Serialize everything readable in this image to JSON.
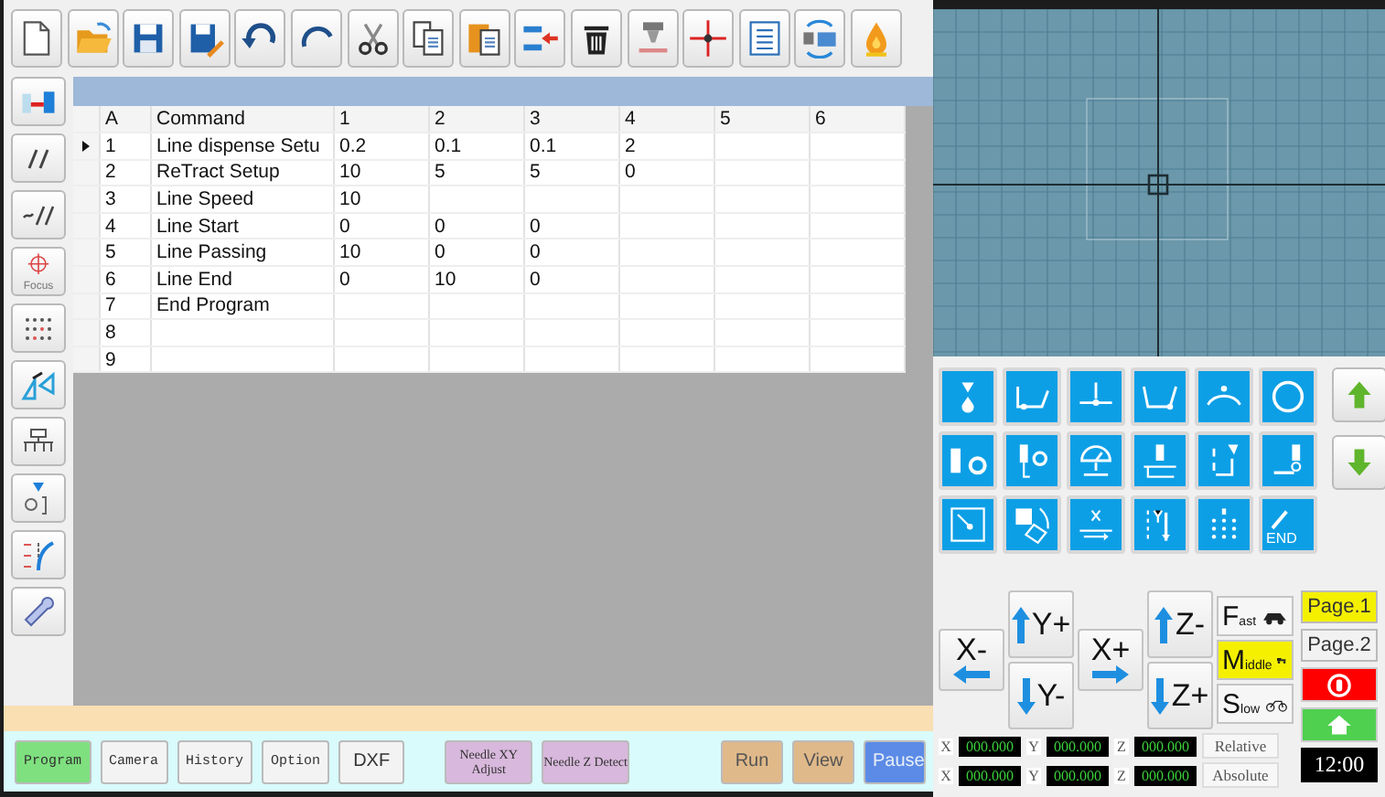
{
  "sidebar": {
    "focus_label": "Focus"
  },
  "grid": {
    "columns": [
      "A",
      "Command",
      "1",
      "2",
      "3",
      "4",
      "5",
      "6"
    ],
    "rows": [
      {
        "cells": [
          "1",
          "Line dispense Setu",
          "0.2",
          "0.1",
          "0.1",
          "2"
        ],
        "current": true
      },
      {
        "cells": [
          "2",
          "ReTract Setup",
          "10",
          "5",
          "5",
          "0"
        ],
        "current": false
      },
      {
        "cells": [
          "3",
          "Line Speed",
          "10"
        ],
        "current": false
      },
      {
        "cells": [
          "4",
          "Line Start",
          "0",
          "0",
          "0"
        ],
        "current": false
      },
      {
        "cells": [
          "5",
          "Line Passing",
          "10",
          "0",
          "0"
        ],
        "current": false
      },
      {
        "cells": [
          "6",
          "Line End",
          "0",
          "10",
          "0"
        ],
        "current": false
      },
      {
        "cells": [
          "7",
          "End Program"
        ],
        "current": false
      },
      {
        "cells": [
          "8"
        ],
        "current": false
      },
      {
        "cells": [
          "9"
        ],
        "current": false
      }
    ]
  },
  "function_pad": {
    "end_label": "END"
  },
  "jog": {
    "buttons": [
      {
        "label": "X-"
      },
      {
        "label": "Y+"
      },
      {
        "label": "Y-"
      },
      {
        "label": "X+"
      },
      {
        "label": "Z-"
      },
      {
        "label": "Z+"
      }
    ],
    "speeds": [
      {
        "label": "Fast",
        "selected": false
      },
      {
        "label": "Middle",
        "selected": true
      },
      {
        "label": "Slow",
        "selected": false
      }
    ],
    "pages": [
      {
        "label": "Page.1",
        "selected": true
      },
      {
        "label": "Page.2",
        "selected": false
      }
    ],
    "clock": "12:00",
    "readouts": [
      {
        "mode": "Relative",
        "axes": [
          {
            "axis": "X",
            "value": "000.000"
          },
          {
            "axis": "Y",
            "value": "000.000"
          },
          {
            "axis": "Z",
            "value": "000.000"
          }
        ]
      },
      {
        "mode": "Absolute",
        "axes": [
          {
            "axis": "X",
            "value": "000.000"
          },
          {
            "axis": "Y",
            "value": "000.000"
          },
          {
            "axis": "Z",
            "value": "000.000"
          }
        ]
      }
    ]
  },
  "bottom_bar": {
    "tabs": [
      {
        "label": "Program",
        "selected": true
      },
      {
        "label": "Camera",
        "selected": false
      },
      {
        "label": "History",
        "selected": false
      },
      {
        "label": "Option",
        "selected": false
      },
      {
        "label": "DXF",
        "selected": false
      }
    ],
    "needle_buttons": [
      "Needle XY Adjust",
      "Needle Z Detect"
    ],
    "actions": [
      {
        "label": "Run",
        "kind": "normal"
      },
      {
        "label": "View",
        "kind": "normal"
      },
      {
        "label": "Pause",
        "kind": "pause"
      }
    ]
  }
}
